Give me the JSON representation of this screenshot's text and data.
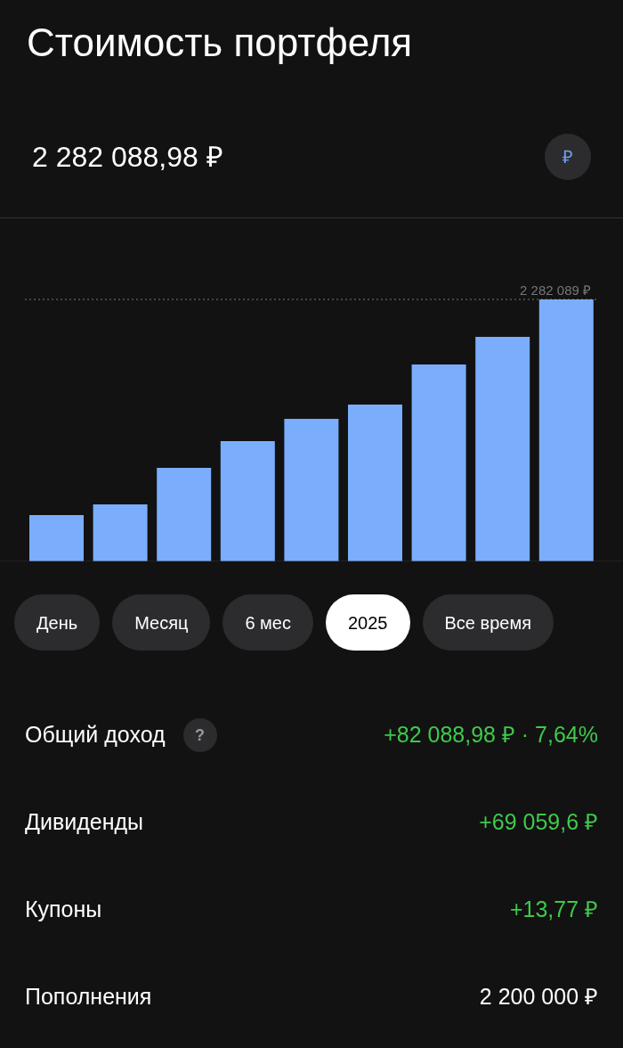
{
  "title": "Стоимость портфеля",
  "total": "2 282 088,98 ₽",
  "currency_button": "₽",
  "chart": {
    "max_label": "2 282 089 ₽"
  },
  "periods": [
    {
      "label": "День",
      "selected": false
    },
    {
      "label": "Месяц",
      "selected": false
    },
    {
      "label": "6 мес",
      "selected": false
    },
    {
      "label": "2025",
      "selected": true
    },
    {
      "label": "Все время",
      "selected": false
    }
  ],
  "stats": [
    {
      "label": "Общий доход",
      "help": "?",
      "value": "+82 088,98 ₽ · 7,64%",
      "positive": true
    },
    {
      "label": "Дивиденды",
      "value": "+69 059,6 ₽",
      "positive": true
    },
    {
      "label": "Купоны",
      "value": "+13,77 ₽",
      "positive": true
    },
    {
      "label": "Пополнения",
      "value": "2 200 000 ₽",
      "positive": false
    }
  ]
}
